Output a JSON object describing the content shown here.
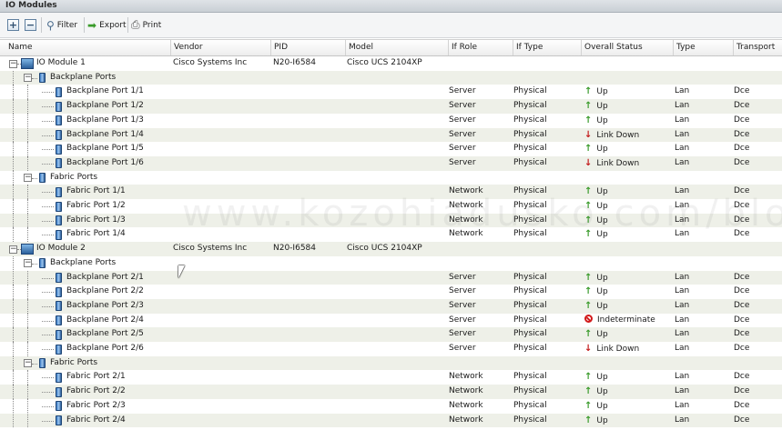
{
  "window": {
    "title": "IO Modules"
  },
  "toolbar": {
    "expand_label": "+",
    "collapse_label": "−",
    "filter_label": "Filter",
    "export_label": "Export",
    "print_label": "Print"
  },
  "columns": [
    {
      "key": "name",
      "label": "Name"
    },
    {
      "key": "vendor",
      "label": "Vendor"
    },
    {
      "key": "pid",
      "label": "PID"
    },
    {
      "key": "model",
      "label": "Model"
    },
    {
      "key": "ifrole",
      "label": "If Role"
    },
    {
      "key": "iftype",
      "label": "If Type"
    },
    {
      "key": "status",
      "label": "Overall Status"
    },
    {
      "key": "type",
      "label": "Type"
    },
    {
      "key": "transport",
      "label": "Transport"
    }
  ],
  "status_icons": {
    "Up": "up-arrow-icon",
    "Link Down": "down-arrow-icon",
    "Indeterminate": "blocked-icon"
  },
  "colors": {
    "up": "#3a9b2b",
    "down": "#c31a1a",
    "row_alt": "#eef0e8"
  },
  "watermark": "www.kozohiadusko.com/blo",
  "rows": [
    {
      "level": 0,
      "kind": "module",
      "name": "IO Module 1",
      "vendor": "Cisco Systems Inc",
      "pid": "N20-I6584",
      "model": "Cisco UCS 2104XP",
      "ifrole": "",
      "iftype": "",
      "status": "",
      "type": "",
      "transport": ""
    },
    {
      "level": 1,
      "kind": "group",
      "name": "Backplane Ports"
    },
    {
      "level": 2,
      "kind": "port",
      "name": "Backplane Port 1/1",
      "ifrole": "Server",
      "iftype": "Physical",
      "status": "Up",
      "type": "Lan",
      "transport": "Dce"
    },
    {
      "level": 2,
      "kind": "port",
      "name": "Backplane Port 1/2",
      "ifrole": "Server",
      "iftype": "Physical",
      "status": "Up",
      "type": "Lan",
      "transport": "Dce"
    },
    {
      "level": 2,
      "kind": "port",
      "name": "Backplane Port 1/3",
      "ifrole": "Server",
      "iftype": "Physical",
      "status": "Up",
      "type": "Lan",
      "transport": "Dce"
    },
    {
      "level": 2,
      "kind": "port",
      "name": "Backplane Port 1/4",
      "ifrole": "Server",
      "iftype": "Physical",
      "status": "Link Down",
      "type": "Lan",
      "transport": "Dce"
    },
    {
      "level": 2,
      "kind": "port",
      "name": "Backplane Port 1/5",
      "ifrole": "Server",
      "iftype": "Physical",
      "status": "Up",
      "type": "Lan",
      "transport": "Dce"
    },
    {
      "level": 2,
      "kind": "port",
      "name": "Backplane Port 1/6",
      "ifrole": "Server",
      "iftype": "Physical",
      "status": "Link Down",
      "type": "Lan",
      "transport": "Dce"
    },
    {
      "level": 1,
      "kind": "group",
      "name": "Fabric Ports"
    },
    {
      "level": 2,
      "kind": "port",
      "name": "Fabric Port 1/1",
      "ifrole": "Network",
      "iftype": "Physical",
      "status": "Up",
      "type": "Lan",
      "transport": "Dce"
    },
    {
      "level": 2,
      "kind": "port",
      "name": "Fabric Port 1/2",
      "ifrole": "Network",
      "iftype": "Physical",
      "status": "Up",
      "type": "Lan",
      "transport": "Dce"
    },
    {
      "level": 2,
      "kind": "port",
      "name": "Fabric Port 1/3",
      "ifrole": "Network",
      "iftype": "Physical",
      "status": "Up",
      "type": "Lan",
      "transport": "Dce"
    },
    {
      "level": 2,
      "kind": "port",
      "name": "Fabric Port 1/4",
      "ifrole": "Network",
      "iftype": "Physical",
      "status": "Up",
      "type": "Lan",
      "transport": "Dce"
    },
    {
      "level": 0,
      "kind": "module",
      "name": "IO Module 2",
      "vendor": "Cisco Systems Inc",
      "pid": "N20-I6584",
      "model": "Cisco UCS 2104XP",
      "ifrole": "",
      "iftype": "",
      "status": "",
      "type": "",
      "transport": ""
    },
    {
      "level": 1,
      "kind": "group",
      "name": "Backplane Ports"
    },
    {
      "level": 2,
      "kind": "port",
      "name": "Backplane Port 2/1",
      "ifrole": "Server",
      "iftype": "Physical",
      "status": "Up",
      "type": "Lan",
      "transport": "Dce"
    },
    {
      "level": 2,
      "kind": "port",
      "name": "Backplane Port 2/2",
      "ifrole": "Server",
      "iftype": "Physical",
      "status": "Up",
      "type": "Lan",
      "transport": "Dce"
    },
    {
      "level": 2,
      "kind": "port",
      "name": "Backplane Port 2/3",
      "ifrole": "Server",
      "iftype": "Physical",
      "status": "Up",
      "type": "Lan",
      "transport": "Dce"
    },
    {
      "level": 2,
      "kind": "port",
      "name": "Backplane Port 2/4",
      "ifrole": "Server",
      "iftype": "Physical",
      "status": "Indeterminate",
      "type": "Lan",
      "transport": "Dce"
    },
    {
      "level": 2,
      "kind": "port",
      "name": "Backplane Port 2/5",
      "ifrole": "Server",
      "iftype": "Physical",
      "status": "Up",
      "type": "Lan",
      "transport": "Dce"
    },
    {
      "level": 2,
      "kind": "port",
      "name": "Backplane Port 2/6",
      "ifrole": "Server",
      "iftype": "Physical",
      "status": "Link Down",
      "type": "Lan",
      "transport": "Dce"
    },
    {
      "level": 1,
      "kind": "group",
      "name": "Fabric Ports"
    },
    {
      "level": 2,
      "kind": "port",
      "name": "Fabric Port 2/1",
      "ifrole": "Network",
      "iftype": "Physical",
      "status": "Up",
      "type": "Lan",
      "transport": "Dce"
    },
    {
      "level": 2,
      "kind": "port",
      "name": "Fabric Port 2/2",
      "ifrole": "Network",
      "iftype": "Physical",
      "status": "Up",
      "type": "Lan",
      "transport": "Dce"
    },
    {
      "level": 2,
      "kind": "port",
      "name": "Fabric Port 2/3",
      "ifrole": "Network",
      "iftype": "Physical",
      "status": "Up",
      "type": "Lan",
      "transport": "Dce"
    },
    {
      "level": 2,
      "kind": "port",
      "name": "Fabric Port 2/4",
      "ifrole": "Network",
      "iftype": "Physical",
      "status": "Up",
      "type": "Lan",
      "transport": "Dce"
    }
  ]
}
